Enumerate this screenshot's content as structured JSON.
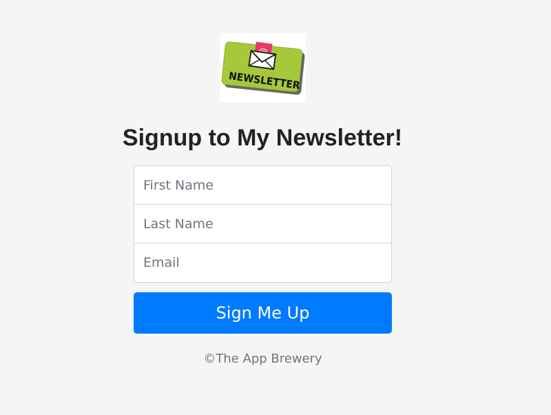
{
  "logo": {
    "text": "NEWSLETTER",
    "at_symbol": "@",
    "icon": "newsletter-envelope-icon"
  },
  "heading": "Signup to My Newsletter!",
  "form": {
    "first_name_placeholder": "First Name",
    "last_name_placeholder": "Last Name",
    "email_placeholder": "Email",
    "submit_label": "Sign Me Up"
  },
  "footer": "©The App Brewery",
  "colors": {
    "background": "#f5f5f5",
    "button": "#007bff",
    "logo_green": "#a6c93c",
    "envelope_pink": "#e8386b"
  }
}
